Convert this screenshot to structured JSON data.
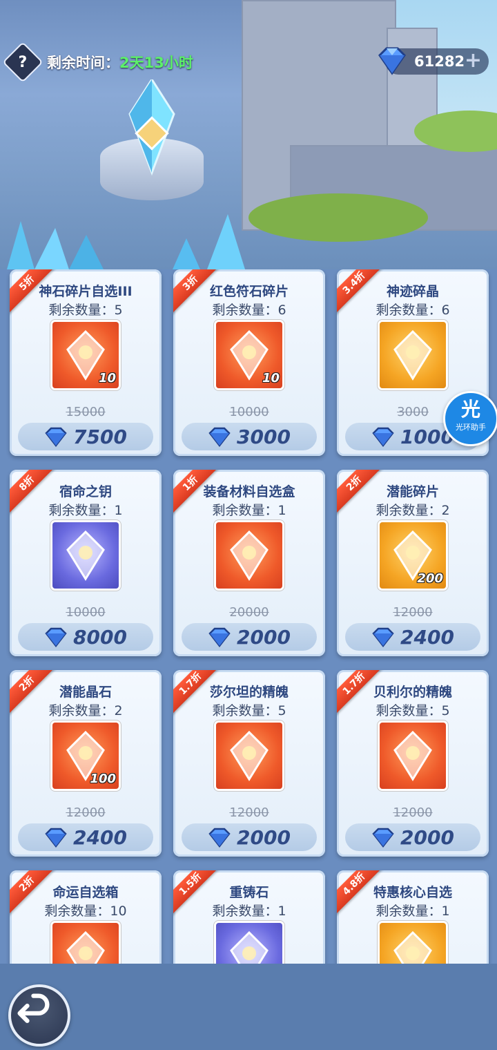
{
  "header": {
    "help_label": "?",
    "time_label": "剩余时间：",
    "time_value": "2天13小时",
    "currency_amount": "61282",
    "currency_plus": "+",
    "currency_icon": "diamond-icon"
  },
  "colors": {
    "time_value": "#5df06a",
    "ribbon": "#e84a2c",
    "price_text": "#2f4a86"
  },
  "stock_label": "剩余数量：",
  "items": [
    {
      "discount": "5折",
      "name": "神石碎片自选III",
      "stock": "5",
      "qty": "10",
      "orig": "15000",
      "price": "7500",
      "icon": "treasure-chest-icon"
    },
    {
      "discount": "3折",
      "name": "红色符石碎片",
      "stock": "6",
      "qty": "10",
      "orig": "10000",
      "price": "3000",
      "icon": "red-rune-icon"
    },
    {
      "discount": "3.4折",
      "name": "神迹碎晶",
      "stock": "6",
      "qty": "",
      "orig": "3000",
      "price": "1000",
      "icon": "crystal-icon"
    },
    {
      "discount": "8折",
      "name": "宿命之钥",
      "stock": "1",
      "qty": "",
      "orig": "10000",
      "price": "8000",
      "icon": "key-icon"
    },
    {
      "discount": "1折",
      "name": "装备材料自选盒",
      "stock": "1",
      "qty": "",
      "orig": "20000",
      "price": "2000",
      "icon": "armor-box-icon"
    },
    {
      "discount": "2折",
      "name": "潜能碎片",
      "stock": "2",
      "qty": "200",
      "orig": "12000",
      "price": "2400",
      "icon": "shard-icon"
    },
    {
      "discount": "2折",
      "name": "潜能晶石",
      "stock": "2",
      "qty": "100",
      "orig": "12000",
      "price": "2400",
      "icon": "star-crystal-icon"
    },
    {
      "discount": "1.7折",
      "name": "莎尔坦的精魄",
      "stock": "5",
      "qty": "",
      "orig": "12000",
      "price": "2000",
      "icon": "dark-orb-icon"
    },
    {
      "discount": "1.7折",
      "name": "贝利尔的精魄",
      "stock": "5",
      "qty": "",
      "orig": "12000",
      "price": "2000",
      "icon": "red-orb-icon"
    },
    {
      "discount": "2折",
      "name": "命运自选箱",
      "stock": "10",
      "qty": "",
      "orig": "",
      "price": "",
      "icon": "fate-chest-icon"
    },
    {
      "discount": "1.5折",
      "name": "重铸石",
      "stock": "1",
      "qty": "",
      "orig": "",
      "price": "",
      "icon": "recast-stone-icon"
    },
    {
      "discount": "4.8折",
      "name": "特惠核心自选",
      "stock": "1",
      "qty": "",
      "orig": "",
      "price": "",
      "icon": "core-card-icon"
    }
  ],
  "assistant": {
    "big": "光",
    "small": "光环助手"
  },
  "back_icon": "back-arrow-icon"
}
